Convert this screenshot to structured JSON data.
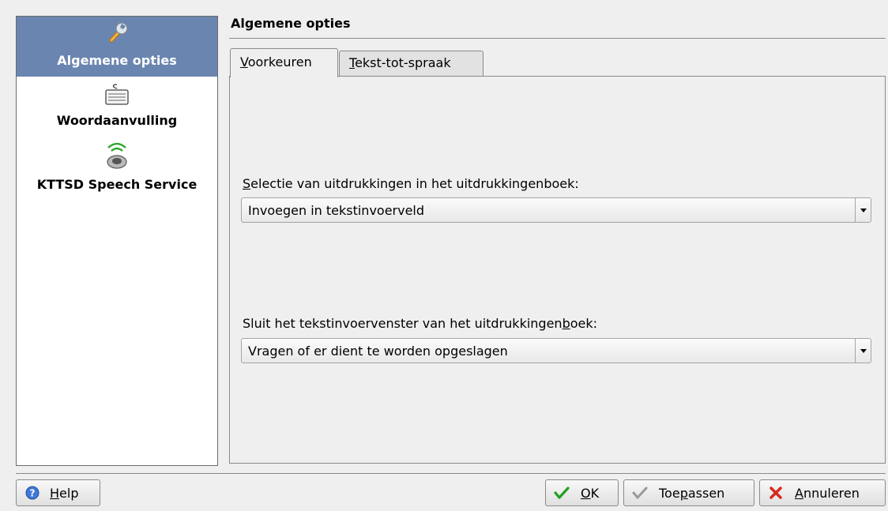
{
  "sidebar": {
    "items": [
      {
        "label": "Algemene opties",
        "icon": "wrench-icon",
        "selected": true
      },
      {
        "label": "Woordaanvulling",
        "icon": "keyboard-icon",
        "selected": false
      },
      {
        "label": "KTTSD Speech Service",
        "icon": "speaker-icon",
        "selected": false
      }
    ]
  },
  "page_title": "Algemene opties",
  "tabs": [
    {
      "label_u": "V",
      "label_rest": "oorkeuren",
      "active": true
    },
    {
      "label_u": "T",
      "label_rest": "ekst-tot-spraak",
      "active": false
    }
  ],
  "fields": {
    "phrasebook_selection": {
      "label_u": "S",
      "label_rest": "electie van uitdrukkingen in het uitdrukkingenboek:",
      "value": "Invoegen in tekstinvoerveld"
    },
    "close_window": {
      "label_pre": "Sluit het tekstinvoervenster van het uitdrukkingen",
      "label_u": "b",
      "label_post": "oek:",
      "value": "Vragen of er dient te worden opgeslagen"
    }
  },
  "buttons": {
    "help": {
      "label_u": "H",
      "label_rest": "elp",
      "icon": "help-icon"
    },
    "ok": {
      "label_u": "O",
      "label_rest": "K",
      "icon": "check-icon"
    },
    "apply": {
      "label_pre": "Toe",
      "label_u": "p",
      "label_post": "assen",
      "icon": "check-gray-icon"
    },
    "cancel": {
      "label_u": "A",
      "label_rest": "nnuleren",
      "icon": "cancel-icon"
    }
  },
  "colors": {
    "selection": "#6a86b0",
    "background": "#efefef"
  }
}
